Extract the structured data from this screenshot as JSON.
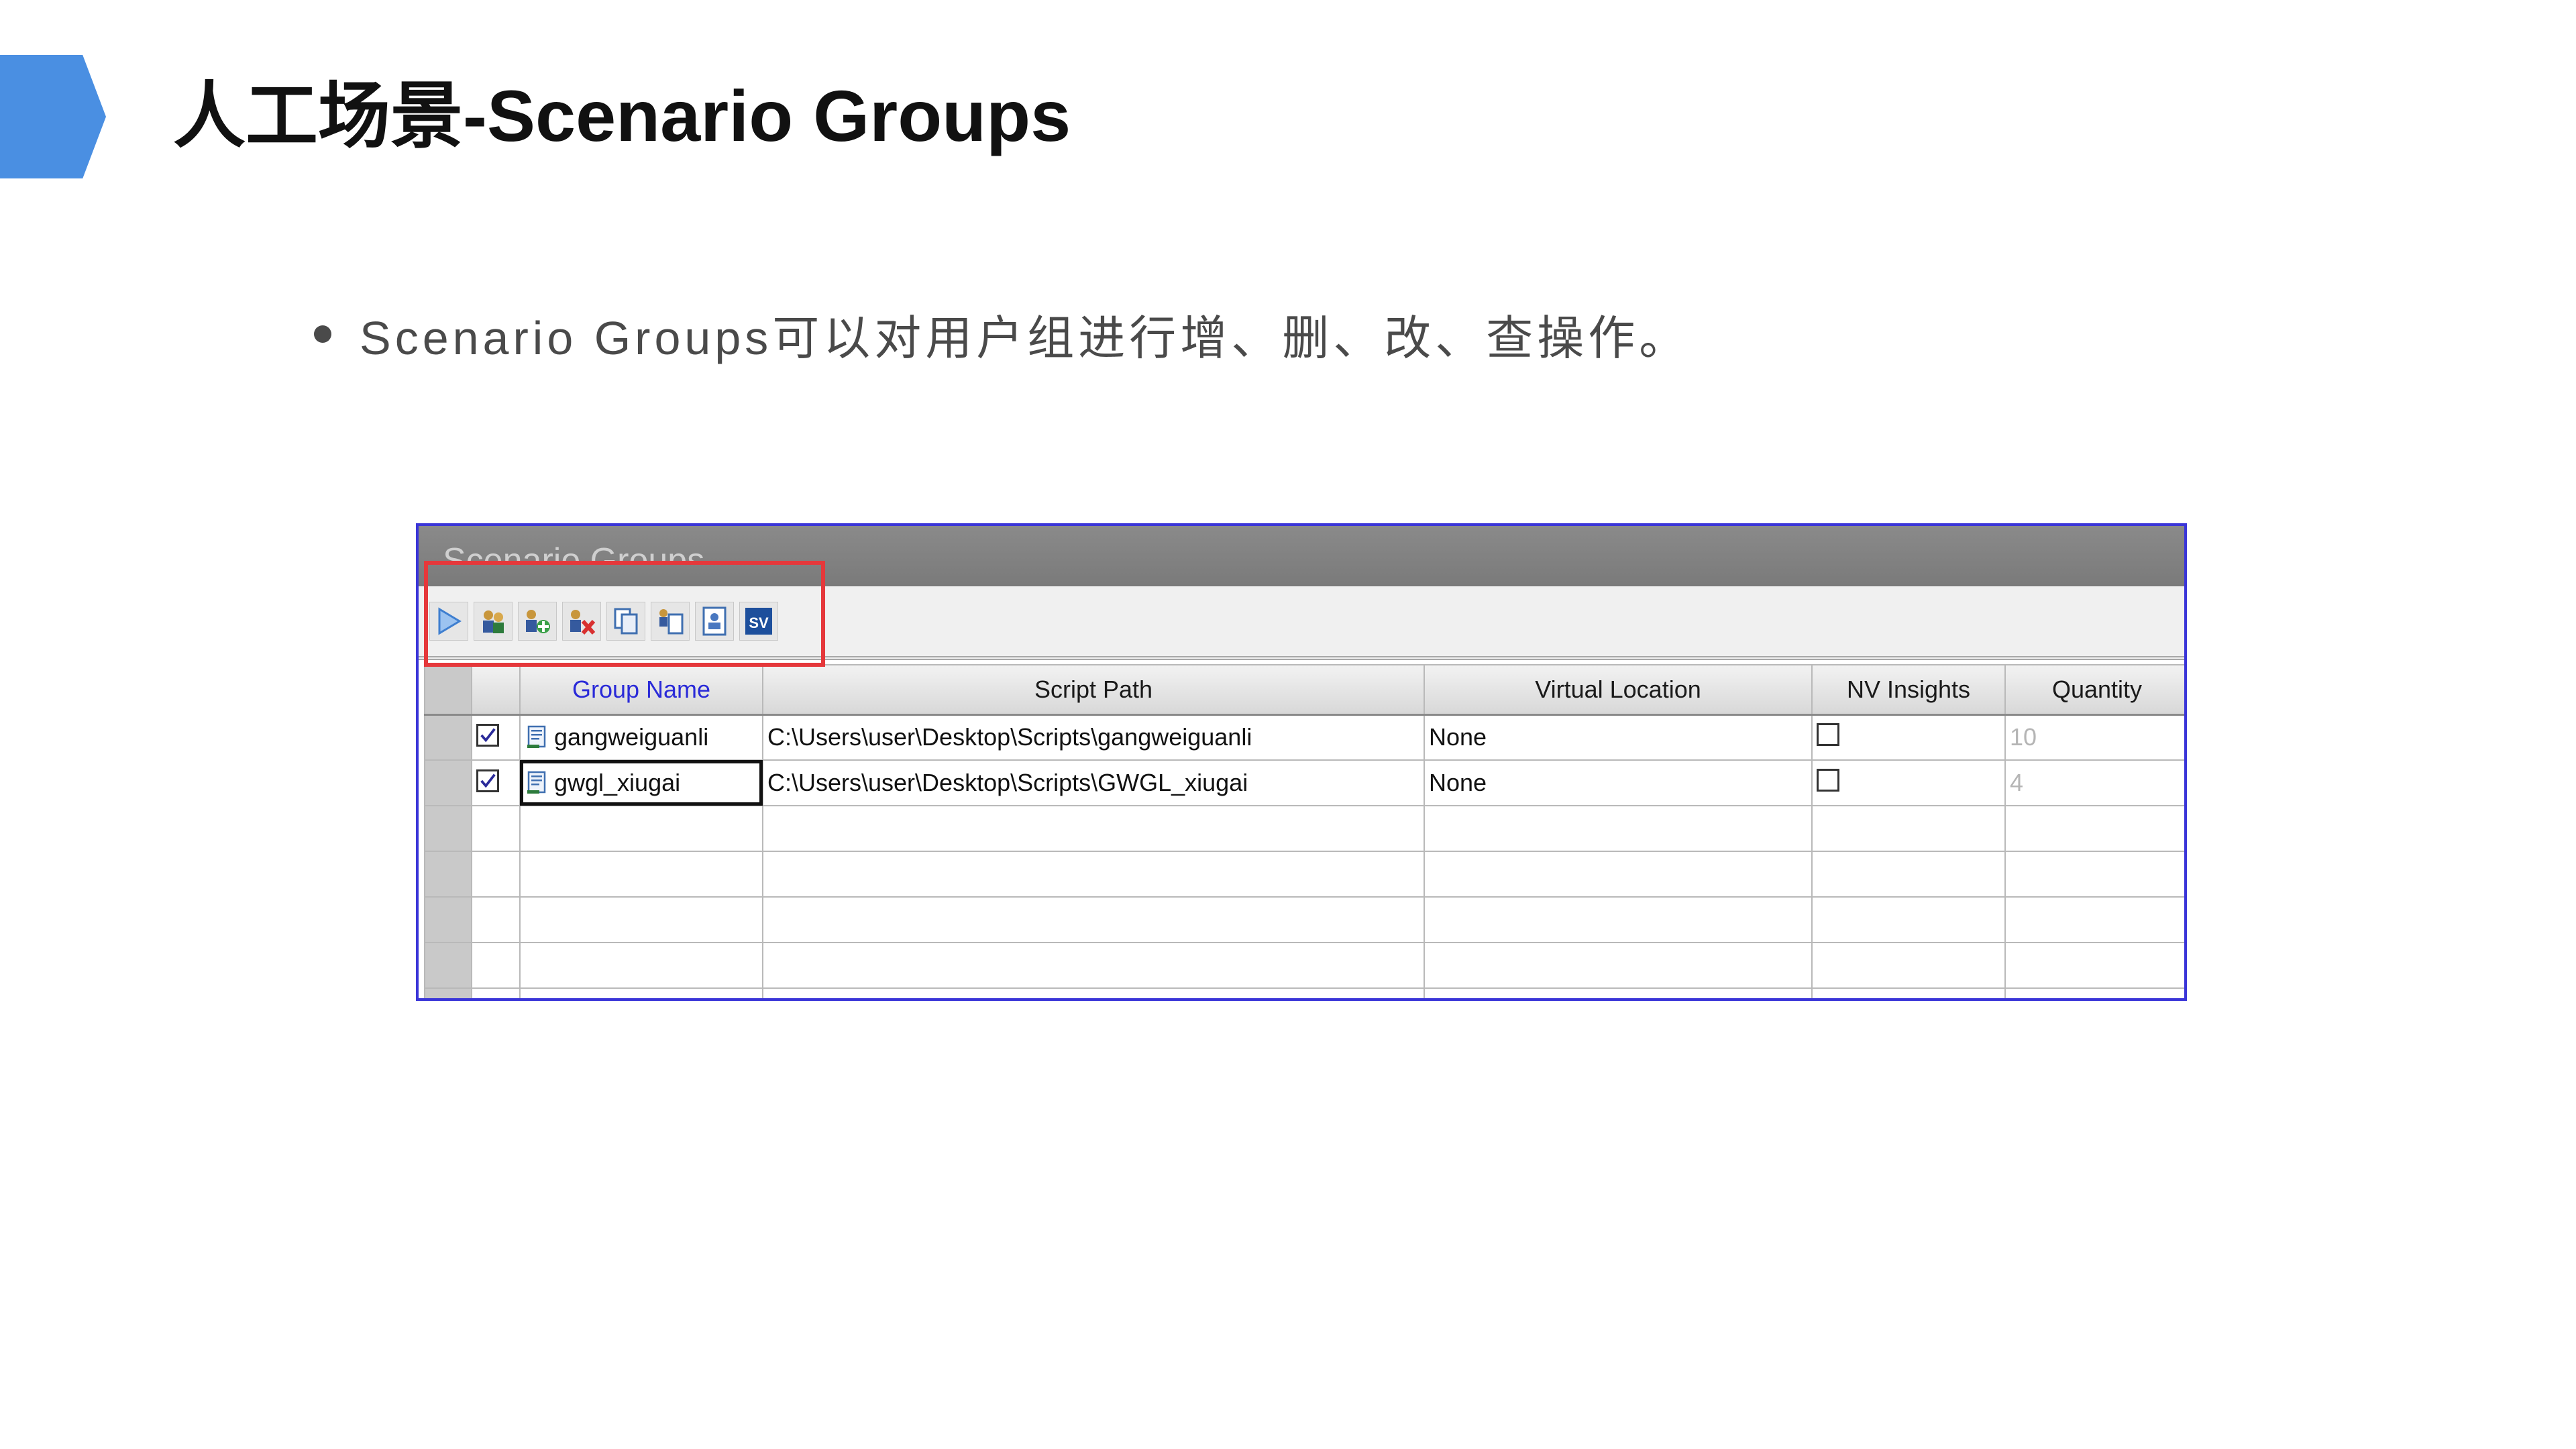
{
  "page": {
    "title": "人工场景-Scenario Groups",
    "bullet": "Scenario Groups可以对用户组进行增、删、改、查操作。"
  },
  "window": {
    "title": "Scenario Groups",
    "toolbar": {
      "buttons": [
        {
          "icon": "play-icon"
        },
        {
          "icon": "group-users-icon"
        },
        {
          "icon": "add-group-icon"
        },
        {
          "icon": "delete-group-icon"
        },
        {
          "icon": "copy-group-icon"
        },
        {
          "icon": "duplicate-group-icon"
        },
        {
          "icon": "group-details-icon"
        },
        {
          "icon": "vuser-script-icon"
        }
      ]
    },
    "table": {
      "columns": [
        "Group Name",
        "Script Path",
        "Virtual Location",
        "NV Insights",
        "Quantity"
      ],
      "rows": [
        {
          "enabled": true,
          "group_name": "gangweiguanli",
          "script_path": "C:\\Users\\user\\Desktop\\Scripts\\gangweiguanli",
          "virtual_location": "None",
          "nv_insights": false,
          "quantity": "10"
        },
        {
          "enabled": true,
          "group_name": "gwgl_xiugai",
          "script_path": "C:\\Users\\user\\Desktop\\Scripts\\GWGL_xiugai",
          "virtual_location": "None",
          "nv_insights": false,
          "quantity": "4"
        }
      ]
    }
  },
  "colors": {
    "accent": "#4a8fe2",
    "highlight": "#e5383b",
    "window_border": "#3a35d8",
    "active_column": "#2a2ad8"
  }
}
